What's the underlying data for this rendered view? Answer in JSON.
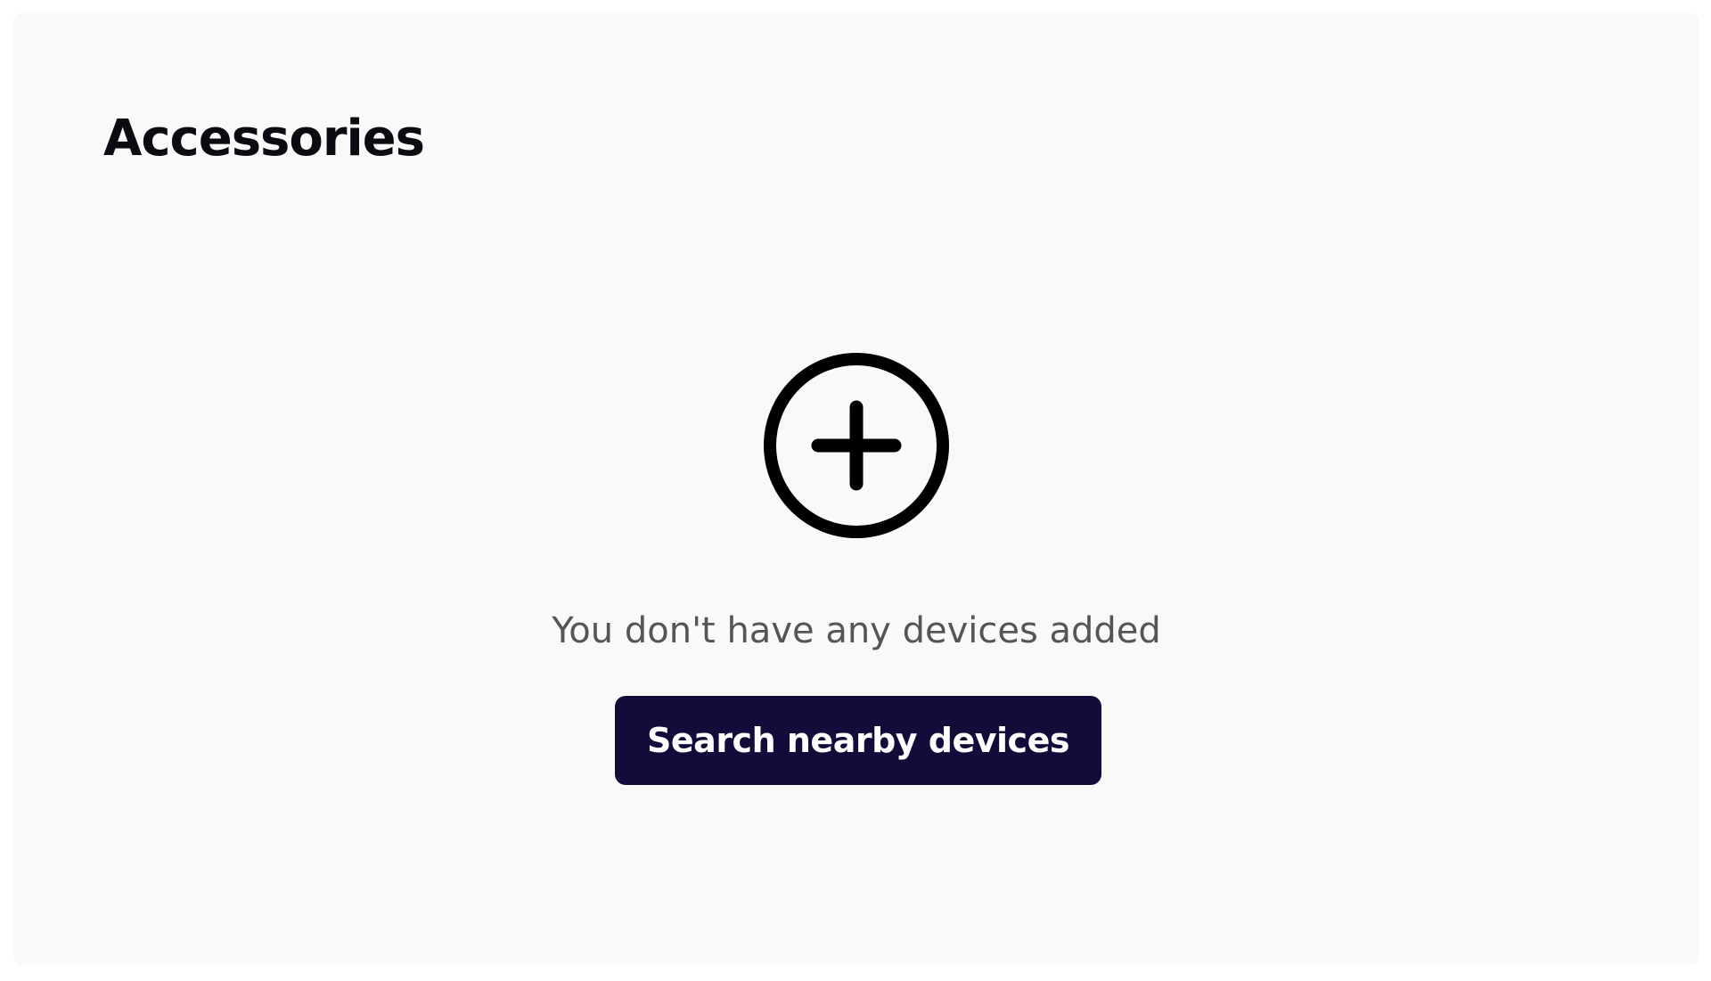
{
  "page": {
    "title": "Accessories"
  },
  "empty_state": {
    "icon": "add-circle-icon",
    "message": "You don't have any devices added",
    "button_label": "Search nearby devices"
  },
  "colors": {
    "panel_background": "#f9f9f9",
    "button_background": "#120c3b",
    "button_text": "#ffffff",
    "message_text": "#555555",
    "title_text": "#0b0b12"
  }
}
